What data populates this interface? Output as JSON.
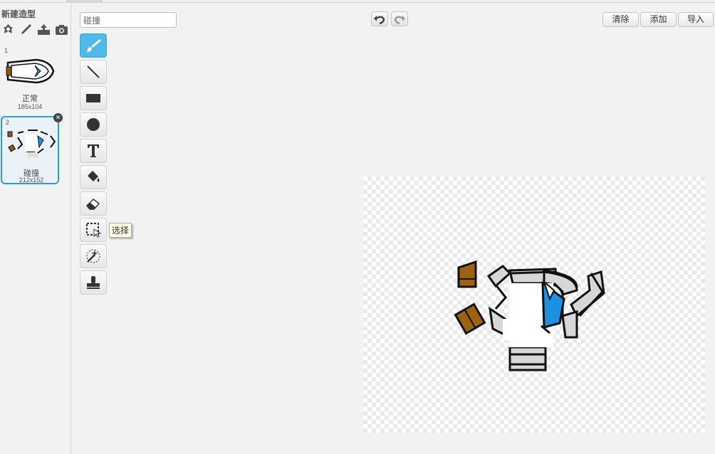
{
  "costume_panel": {
    "new_costume_label": "新建造型",
    "tools": [
      "choose-from-library-icon",
      "paint-brush-icon",
      "upload-icon",
      "camera-icon"
    ],
    "costumes": [
      {
        "index": "1",
        "name": "正常",
        "size": "185x104",
        "selected": false
      },
      {
        "index": "2",
        "name": "碰撞",
        "size": "212x152",
        "selected": true
      }
    ]
  },
  "editor": {
    "costume_name": "碰撞",
    "clear_label": "清除",
    "add_label": "添加",
    "import_label": "导入",
    "tool_tooltip": "选择",
    "tools": [
      "brush-icon",
      "line-icon",
      "rectangle-icon",
      "ellipse-icon",
      "text-icon",
      "fill-icon",
      "eraser-icon",
      "select-icon",
      "magic-select-icon",
      "stamp-icon"
    ],
    "active_tool": "brush-icon",
    "accent_color": "#4fb9e8"
  }
}
